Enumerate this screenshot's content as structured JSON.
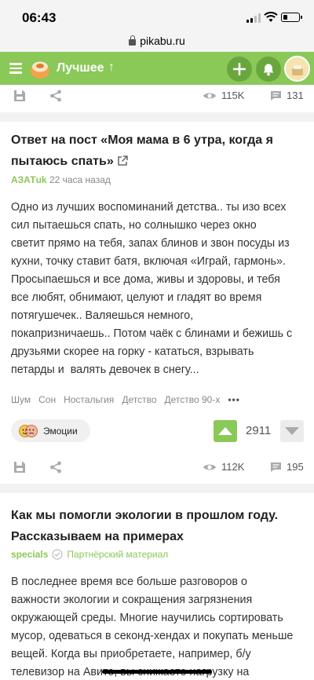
{
  "status": {
    "time": "06:43"
  },
  "browser": {
    "url": "pikabu.ru"
  },
  "header": {
    "title": "Лучшее",
    "arrow": "↑"
  },
  "post_prev": {
    "views": "115K",
    "comments": "131"
  },
  "post1": {
    "title_line1": "Ответ на пост «Моя мама в 6 утра, когда я",
    "title_line2": "пытаюсь спать»",
    "author": "АЗАТuk",
    "time_ago": "22 часа назад",
    "body_lines": [
      "Одно из лучших воспоминаний детства.. ты изо всех",
      "сил пытаешься спать, но солнышко через окно",
      "светит прямо на тебя, запах блинов и звон посуды из",
      "кухни, точку ставит батя, включая «Играй, гармонь».",
      "Просыпаешься и все дома, живы и здоровы, и тебя",
      "все любят, обнимают, целуют и гладят во время",
      "потягушечек.. Валяешься немного,",
      "покапризничаешь.. Потом чаёк с блинами и бежишь с",
      "друзьями скорее на горку - кататься, взрывать",
      "петарды и  валять девочек в снегу..."
    ],
    "tags": [
      "Шум",
      "Сон",
      "Ностальгия",
      "Детство",
      "Детство 90-х"
    ],
    "more": "•••",
    "community": "Эмоции",
    "rating": "2911",
    "views": "112K",
    "comments": "195"
  },
  "post2": {
    "title_line1": "Как мы помогли экологии в прошлом году.",
    "title_line2": "Рассказываем на примерах",
    "author": "specials",
    "partner_label": "Партнёрский материал",
    "body_lines": [
      "В последнее время все больше разговоров о",
      "важности экологии и сокращения загрязнения",
      "окружающей среды. Многие научились сортировать",
      "мусор, одеваться в секонд-хендах и покупать меньше",
      "вещей. Когда вы приобретаете, например, б/у",
      "телевизор на Авито, вы снижаете нагрузку на"
    ]
  },
  "colors": {
    "accent": "#8ac858",
    "accent_dark": "#6aa63e"
  }
}
